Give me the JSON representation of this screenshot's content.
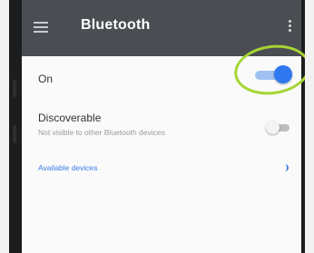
{
  "appbar": {
    "title": "Bluetooth",
    "menu_icon": "hamburger-menu-icon",
    "more_icon": "more-vert-icon",
    "color": "#4a4d52"
  },
  "settings": {
    "on": {
      "label": "On",
      "enabled": true
    },
    "discoverable": {
      "title": "Discoverable",
      "subtitle": "Not visible to other Bluetooth devices",
      "enabled": false
    },
    "available_devices": {
      "label": "Available devices",
      "loading": true
    }
  },
  "colors": {
    "accent": "#2f78f0",
    "highlight": "#a6d532",
    "section_label": "#3d7de8"
  }
}
